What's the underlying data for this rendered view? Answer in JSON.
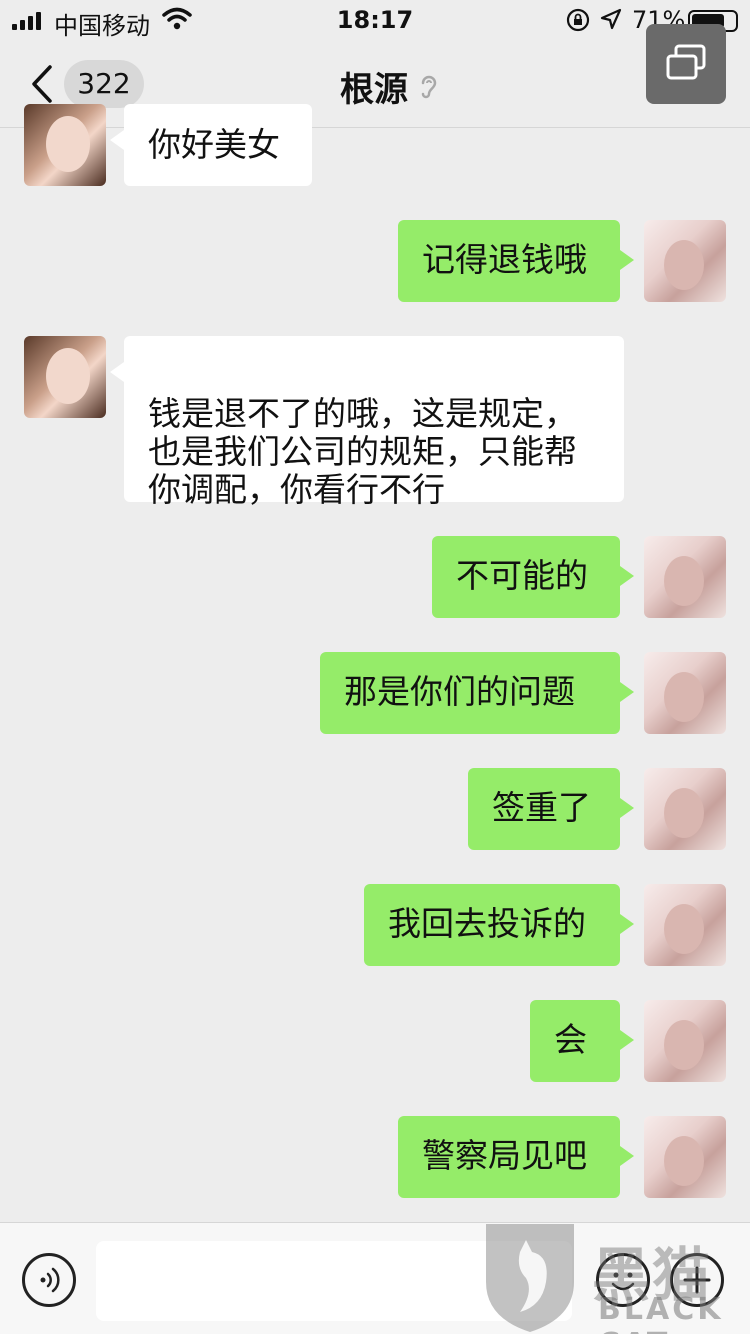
{
  "status_bar": {
    "carrier": "中国移动",
    "time": "18:17",
    "battery_percent": "71%"
  },
  "nav": {
    "unread_count": "322",
    "title": "根源"
  },
  "messages": [
    {
      "side": "left",
      "text": "你好美女"
    },
    {
      "side": "right",
      "text": "记得退钱哦"
    },
    {
      "side": "left",
      "text": "钱是退不了的哦，这是规定，\n也是我们公司的规矩，只能帮\n你调配，你看行不行"
    },
    {
      "side": "right",
      "text": "不可能的"
    },
    {
      "side": "right",
      "text": "那是你们的问题"
    },
    {
      "side": "right",
      "text": "签重了"
    },
    {
      "side": "right",
      "text": "我回去投诉的"
    },
    {
      "side": "right",
      "text": "会"
    },
    {
      "side": "right",
      "text": "警察局见吧"
    }
  ],
  "input_bar": {
    "placeholder": ""
  },
  "watermark": {
    "cn": "黑猫",
    "en": "BLACK CAT"
  },
  "colors": {
    "background": "#ededed",
    "bubble_self": "#95ec69",
    "bubble_other": "#ffffff"
  }
}
